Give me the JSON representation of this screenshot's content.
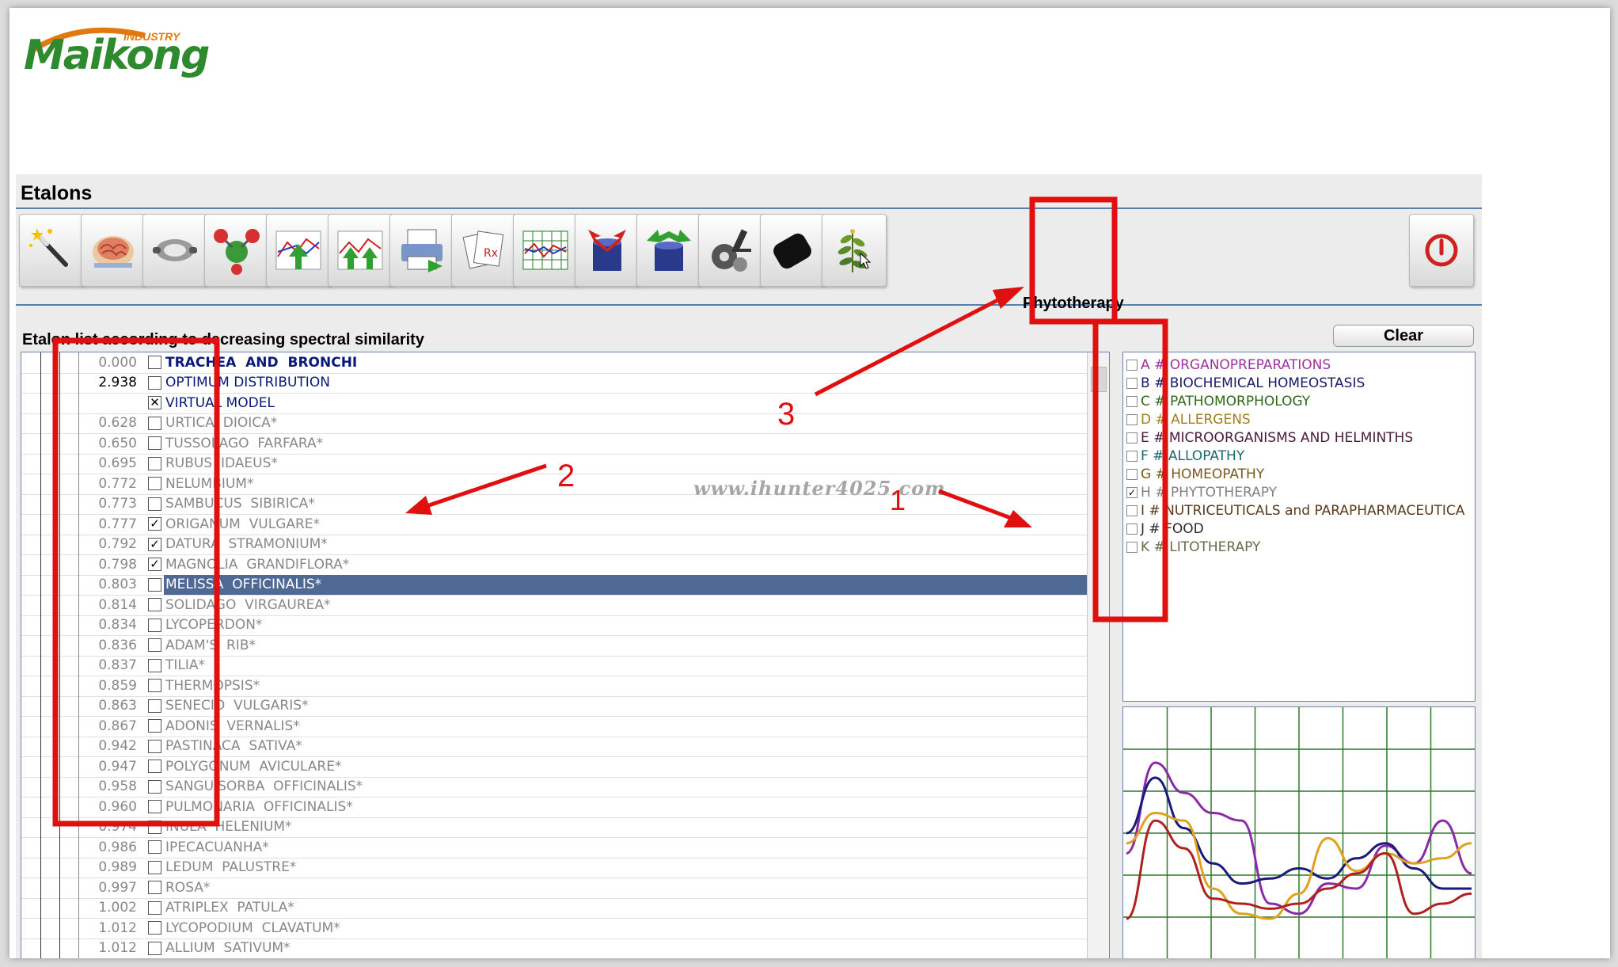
{
  "logo": {
    "brand": "Maikong",
    "sub": "INDUSTRY"
  },
  "window": {
    "title": "Etalons"
  },
  "toolbar": {
    "buttons": [
      {
        "icon": "magic-wand-icon"
      },
      {
        "icon": "brain-icon"
      },
      {
        "icon": "organ-icon"
      },
      {
        "icon": "molecule-icon"
      },
      {
        "icon": "spectrum-up-icon"
      },
      {
        "icon": "spectrum-double-up-icon"
      },
      {
        "icon": "printer-icon"
      },
      {
        "icon": "documents-icon"
      },
      {
        "icon": "grid-chart-icon"
      },
      {
        "icon": "container-down-icon"
      },
      {
        "icon": "container-up-icon"
      },
      {
        "icon": "gears-microscope-icon"
      },
      {
        "icon": "black-bag-icon"
      },
      {
        "icon": "plant-icon"
      }
    ],
    "power_icon": "power-icon",
    "hover_label": "Phytotherapy"
  },
  "list": {
    "caption": "Etalon list according to decreasing spectral similarity",
    "rows": [
      {
        "value": "0.000",
        "name": "TRACHEA  AND  BRONCHI",
        "check": "",
        "style": "bold"
      },
      {
        "value": "2.938",
        "name": "OPTIMUM DISTRIBUTION",
        "check": "",
        "style": "top"
      },
      {
        "value": "",
        "name": "VIRTUAL MODEL",
        "check": "✕",
        "style": "top"
      },
      {
        "value": "0.628",
        "name": "URTICA  DIOICA*",
        "check": "",
        "style": ""
      },
      {
        "value": "0.650",
        "name": "TUSSOLAGO  FARFARA*",
        "check": "",
        "style": ""
      },
      {
        "value": "0.695",
        "name": "RUBUS  IDAEUS*",
        "check": "",
        "style": ""
      },
      {
        "value": "0.772",
        "name": "NELUMBIUM*",
        "check": "",
        "style": ""
      },
      {
        "value": "0.773",
        "name": "SAMBUCUS  SIBIRICA*",
        "check": "",
        "style": ""
      },
      {
        "value": "0.777",
        "name": "ORIGANUM  VULGARE*",
        "check": "✓",
        "style": ""
      },
      {
        "value": "0.792",
        "name": "DATURA  STRAMONIUM*",
        "check": "✓",
        "style": ""
      },
      {
        "value": "0.798",
        "name": "MAGNOLIA  GRANDIFLORA*",
        "check": "✓",
        "style": ""
      },
      {
        "value": "0.803",
        "name": "MELISSA  OFFICINALIS*",
        "check": "",
        "style": "sel"
      },
      {
        "value": "0.814",
        "name": "SOLIDAGO  VIRGAUREA*",
        "check": "",
        "style": ""
      },
      {
        "value": "0.834",
        "name": "LYCOPERDON*",
        "check": "",
        "style": ""
      },
      {
        "value": "0.836",
        "name": "ADAM'S  RIB*",
        "check": "",
        "style": ""
      },
      {
        "value": "0.837",
        "name": "TILIA*",
        "check": "",
        "style": ""
      },
      {
        "value": "0.859",
        "name": "THERMOPSIS*",
        "check": "",
        "style": ""
      },
      {
        "value": "0.863",
        "name": "SENECIO  VULGARIS*",
        "check": "",
        "style": ""
      },
      {
        "value": "0.867",
        "name": "ADONIS  VERNALIS*",
        "check": "",
        "style": ""
      },
      {
        "value": "0.942",
        "name": "PASTINACA  SATIVA*",
        "check": "",
        "style": ""
      },
      {
        "value": "0.947",
        "name": "POLYGONUM  AVICULARE*",
        "check": "",
        "style": ""
      },
      {
        "value": "0.958",
        "name": "SANGUISORBA  OFFICINALIS*",
        "check": "",
        "style": ""
      },
      {
        "value": "0.960",
        "name": "PULMONARIA  OFFICINALIS*",
        "check": "",
        "style": ""
      },
      {
        "value": "0.974",
        "name": "INULA  HELENIUM*",
        "check": "",
        "style": ""
      },
      {
        "value": "0.986",
        "name": "IPECACUANHA*",
        "check": "",
        "style": ""
      },
      {
        "value": "0.989",
        "name": "LEDUM  PALUSTRE*",
        "check": "",
        "style": ""
      },
      {
        "value": "0.997",
        "name": "ROSA*",
        "check": "",
        "style": ""
      },
      {
        "value": "1.002",
        "name": "ATRIPLEX  PATULA*",
        "check": "",
        "style": ""
      },
      {
        "value": "1.012",
        "name": "LYCOPODIUM  CLAVATUM*",
        "check": "",
        "style": ""
      },
      {
        "value": "1.012",
        "name": "ALLIUM  SATIVUM*",
        "check": "",
        "style": ""
      }
    ]
  },
  "clear_label": "Clear",
  "categories": [
    {
      "letter": "A",
      "label": "ORGANOPREPARATIONS",
      "color": "#a030a0",
      "checked": ""
    },
    {
      "letter": "B",
      "label": "BIOCHEMICAL HOMEOSTASIS",
      "color": "#1a1a6a",
      "checked": ""
    },
    {
      "letter": "C",
      "label": "PATHOMORPHOLOGY",
      "color": "#2a6a1a",
      "checked": ""
    },
    {
      "letter": "D",
      "label": "ALLERGENS",
      "color": "#a08020",
      "checked": ""
    },
    {
      "letter": "E",
      "label": "MICROORGANISMS AND HELMINTHS",
      "color": "#4a1a3a",
      "checked": ""
    },
    {
      "letter": "F",
      "label": "ALLOPATHY",
      "color": "#1a6a6a",
      "checked": ""
    },
    {
      "letter": "G",
      "label": "HOMEOPATHY",
      "color": "#7a5a1a",
      "checked": ""
    },
    {
      "letter": "H",
      "label": "PHYTOTHERAPY",
      "color": "#808080",
      "checked": "✓"
    },
    {
      "letter": "I",
      "label": "NUTRICEUTICALS and PARAPHARMACEUTICA",
      "color": "#5a3a1a",
      "checked": ""
    },
    {
      "letter": "J",
      "label": "FOOD",
      "color": "#2a2a2a",
      "checked": ""
    },
    {
      "letter": "K",
      "label": "LITOTHERAPY",
      "color": "#6a6a4a",
      "checked": ""
    }
  ],
  "chart_data": {
    "type": "line",
    "x": [
      0,
      1,
      2,
      3,
      4,
      5,
      6,
      7,
      8,
      9,
      10,
      11,
      12
    ],
    "series": [
      {
        "color": "#8a2aa8",
        "values": [
          0.42,
          0.78,
          0.66,
          0.58,
          0.55,
          0.22,
          0.18,
          0.3,
          0.28,
          0.45,
          0.38,
          0.55,
          0.34
        ]
      },
      {
        "color": "#1a1a7a",
        "values": [
          0.5,
          0.72,
          0.52,
          0.38,
          0.3,
          0.32,
          0.36,
          0.32,
          0.4,
          0.46,
          0.36,
          0.28,
          0.28
        ]
      },
      {
        "color": "#e0a020",
        "values": [
          0.46,
          0.58,
          0.55,
          0.28,
          0.18,
          0.16,
          0.26,
          0.48,
          0.35,
          0.42,
          0.38,
          0.4,
          0.46
        ]
      },
      {
        "color": "#b02020",
        "values": [
          0.16,
          0.55,
          0.44,
          0.24,
          0.22,
          0.2,
          0.22,
          0.28,
          0.34,
          0.42,
          0.18,
          0.22,
          0.26
        ]
      }
    ],
    "grid": true
  },
  "annotations": {
    "labels": [
      "1",
      "2",
      "3"
    ],
    "color": "#e01010"
  },
  "watermark": "www.ihunter4025.com"
}
